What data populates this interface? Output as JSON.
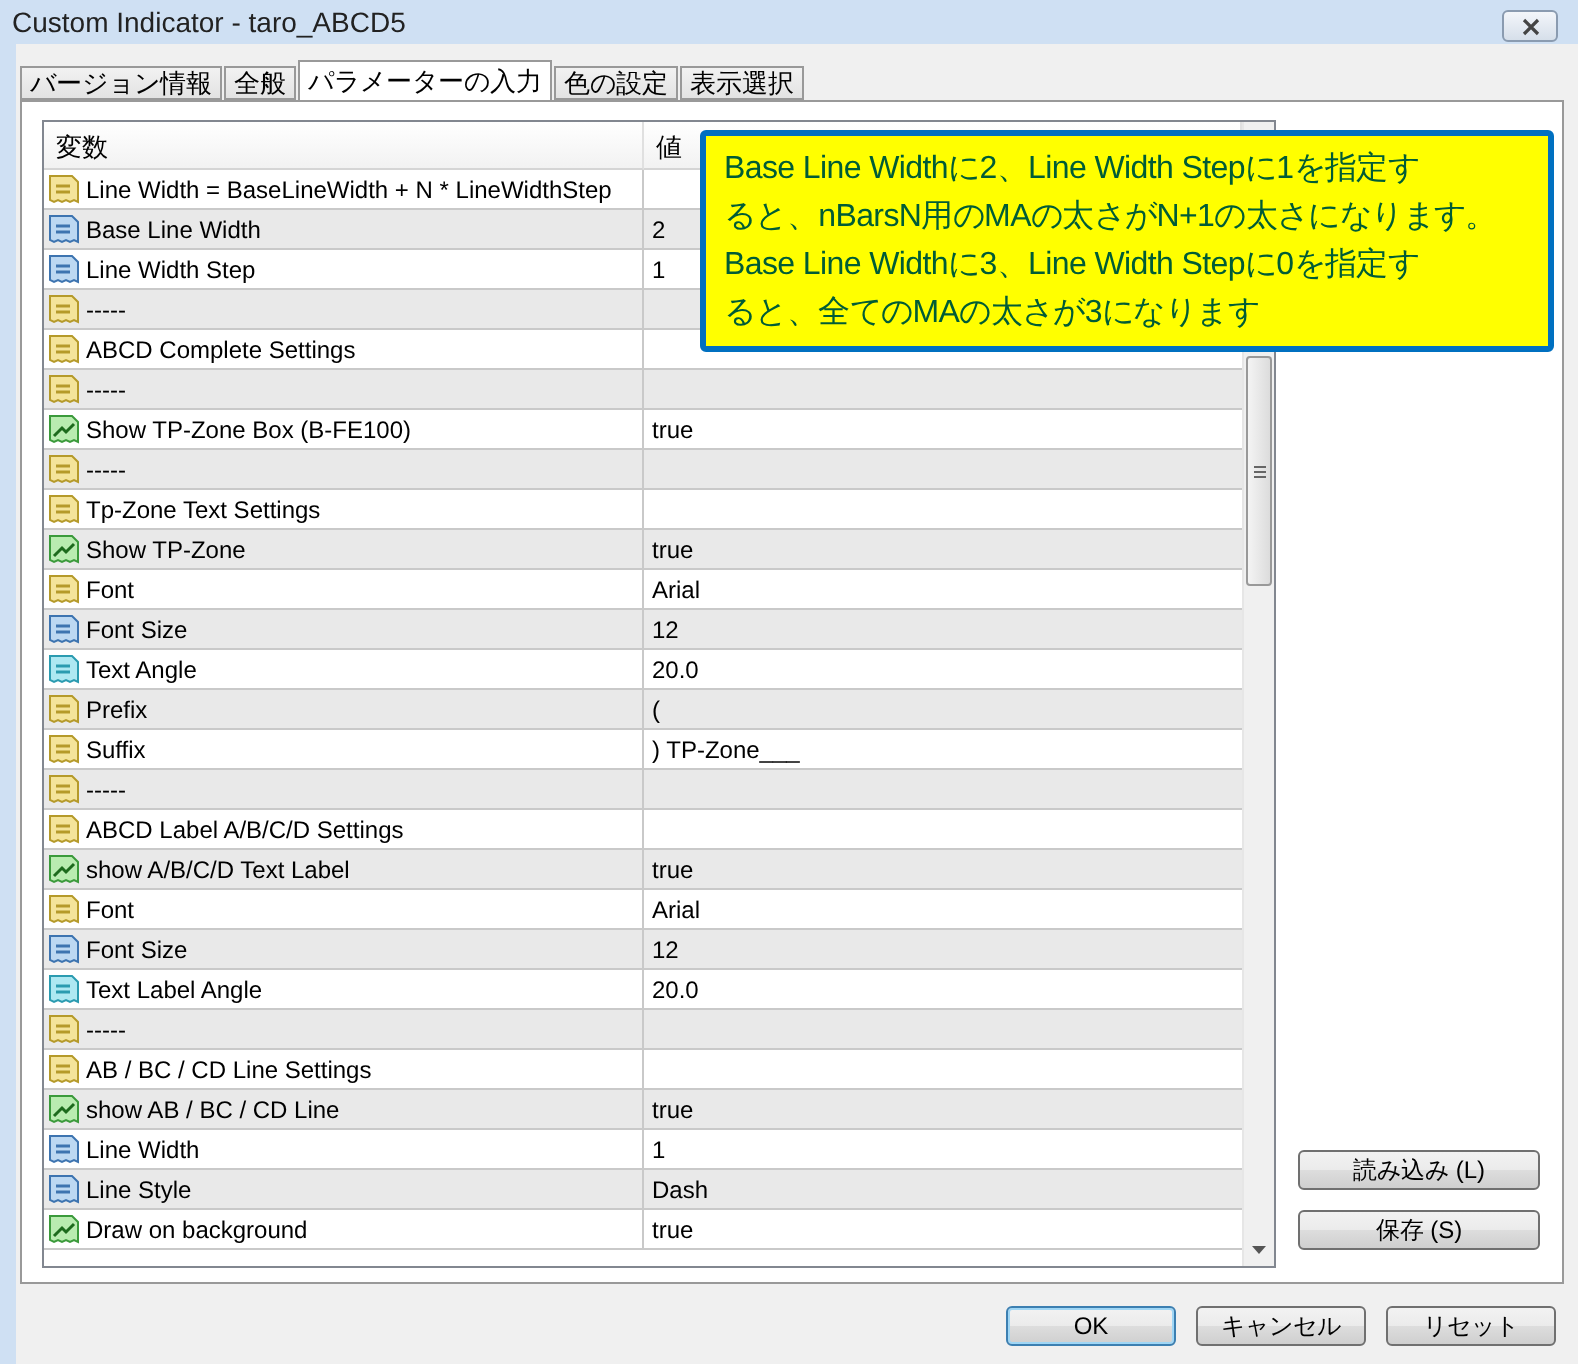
{
  "window": {
    "title": "Custom Indicator - taro_ABCD5"
  },
  "tabs": [
    {
      "label": "バージョン情報",
      "selected": false
    },
    {
      "label": "全般",
      "selected": false
    },
    {
      "label": "パラメーターの入力",
      "selected": true
    },
    {
      "label": "色の設定",
      "selected": false
    },
    {
      "label": "表示選択",
      "selected": false
    }
  ],
  "table": {
    "columns": [
      "変数",
      "値"
    ],
    "rows": [
      {
        "kind": "text",
        "name": "Line Width = BaseLineWidth + N * LineWidthStep"
      },
      {
        "kind": "int",
        "name": "Base Line Width",
        "value": "2"
      },
      {
        "kind": "int",
        "name": "Line Width Step",
        "value": "1"
      },
      {
        "kind": "text",
        "name": "-----"
      },
      {
        "kind": "text",
        "name": "ABCD Complete Settings"
      },
      {
        "kind": "text",
        "name": "-----"
      },
      {
        "kind": "bool",
        "name": "Show TP-Zone Box (B-FE100)",
        "value": "true"
      },
      {
        "kind": "text",
        "name": "-----"
      },
      {
        "kind": "text",
        "name": "Tp-Zone Text Settings"
      },
      {
        "kind": "bool",
        "name": "Show TP-Zone",
        "value": "true"
      },
      {
        "kind": "text",
        "name": "Font",
        "value": "Arial"
      },
      {
        "kind": "int",
        "name": "Font Size",
        "value": "12"
      },
      {
        "kind": "double",
        "name": "Text Angle",
        "value": "20.0"
      },
      {
        "kind": "text",
        "name": "Prefix",
        "value": "("
      },
      {
        "kind": "text",
        "name": "Suffix",
        "value": ") TP-Zone___"
      },
      {
        "kind": "text",
        "name": "-----"
      },
      {
        "kind": "text",
        "name": "ABCD Label A/B/C/D Settings"
      },
      {
        "kind": "bool",
        "name": "show A/B/C/D Text Label",
        "value": "true"
      },
      {
        "kind": "text",
        "name": "Font",
        "value": "Arial"
      },
      {
        "kind": "int",
        "name": "Font Size",
        "value": "12"
      },
      {
        "kind": "double",
        "name": "Text Label Angle",
        "value": "20.0"
      },
      {
        "kind": "text",
        "name": "-----"
      },
      {
        "kind": "text",
        "name": "AB / BC / CD Line Settings"
      },
      {
        "kind": "bool",
        "name": "show AB / BC / CD Line",
        "value": "true"
      },
      {
        "kind": "int",
        "name": "Line Width",
        "value": "1"
      },
      {
        "kind": "int",
        "name": "Line Style",
        "value": "Dash"
      },
      {
        "kind": "bool",
        "name": "Draw on background",
        "value": "true"
      }
    ]
  },
  "callout": {
    "lines": [
      "Base Line Widthに2、Line Width Stepに1を指定す",
      "ると、nBarsN用のMAの太さがN+1の太さになります。",
      "Base Line Widthに3、Line Width Stepに0を指定す",
      "ると、全てのMAの太さが3になります"
    ]
  },
  "side_buttons": [
    "読み込み (L)",
    "保存 (S)"
  ],
  "buttons": [
    {
      "label": "OK",
      "selected": true
    },
    {
      "label": "キャンセル",
      "selected": false
    },
    {
      "label": "リセット",
      "selected": false
    }
  ]
}
